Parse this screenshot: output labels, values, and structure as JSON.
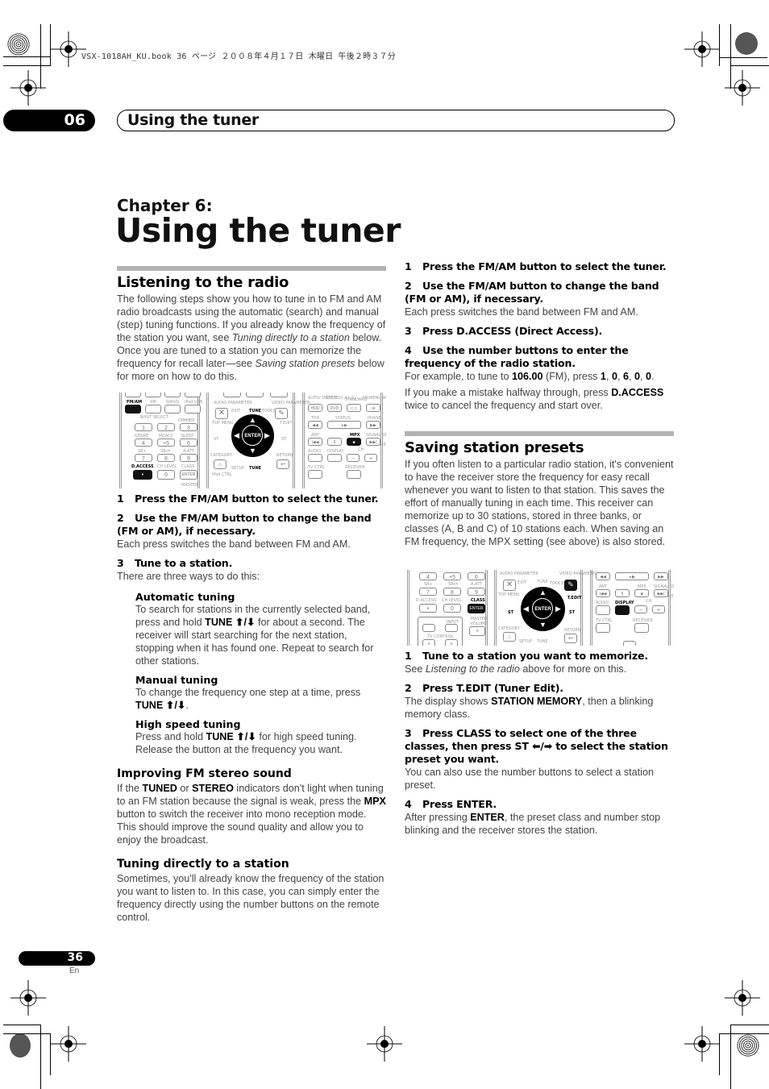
{
  "print_header": "VSX-1018AH_KU.book  36 ページ  ２００８年４月１７日  木曜日  午後２時３７分",
  "chapter_tab": {
    "number": "06"
  },
  "running_header": {
    "title": "Using the tuner"
  },
  "chapter": {
    "label": "Chapter 6:",
    "title": "Using the tuner"
  },
  "left_column": {
    "listening": {
      "heading": "Listening to the radio",
      "intro_parts": [
        "The following steps show you how to tune in to FM and AM radio broadcasts using the automatic (search) and manual (step) tuning functions. If you already know the frequency of the station you want, see ",
        "Tuning directly to a station",
        " below. Once you are tuned to a station you can memorize the frequency for recall later—see ",
        "Saving station presets",
        " below for more on how to do this."
      ]
    },
    "steps": [
      {
        "num": "1",
        "title": "Press the FM/AM button to select the tuner."
      },
      {
        "num": "2",
        "title": "Use the FM/AM button to change the band (FM or AM), if necessary.",
        "body": "Each press switches the band between FM and AM."
      },
      {
        "num": "3",
        "title": "Tune to a station.",
        "body": "There are three ways to do this:"
      }
    ],
    "tuning_methods": [
      {
        "heading": "Automatic tuning",
        "pre": "To search for stations in the currently selected band, press and hold ",
        "bold": "TUNE ⬆/⬇",
        "post": " for about a second. The receiver will start searching for the next station, stopping when it has found one. Repeat to search for other stations."
      },
      {
        "heading": "Manual tuning",
        "pre": "To change the frequency one step at a time, press ",
        "bold": "TUNE ⬆/⬇",
        "post": "."
      },
      {
        "heading": "High speed tuning",
        "pre": "Press and hold ",
        "bold": "TUNE ⬆/⬇",
        "post": " for high speed tuning. Release the button at the frequency you want."
      }
    ],
    "improving": {
      "heading": "Improving FM stereo sound",
      "parts": [
        "If the ",
        "TUNED",
        " or ",
        "STEREO",
        " indicators don't light when tuning to an FM station because the signal is weak, press the ",
        "MPX",
        " button to switch the receiver into mono reception mode. This should improve the sound quality and allow you to enjoy the broadcast."
      ]
    },
    "direct": {
      "heading": "Tuning directly to a station",
      "body": "Sometimes, you'll already know the frequency of the station you want to listen to. In this case, you can simply enter the frequency directly using the number buttons on the remote control."
    }
  },
  "right_column": {
    "direct_steps": [
      {
        "num": "1",
        "title": "Press the FM/AM button to select the tuner."
      },
      {
        "num": "2",
        "title": "Use the FM/AM button to change the band (FM or AM), if necessary.",
        "body": "Each press switches the band between FM and AM."
      },
      {
        "num": "3",
        "title": "Press D.ACCESS (Direct Access)."
      },
      {
        "num": "4",
        "title": "Use the number buttons to enter the frequency of the radio station."
      }
    ],
    "example_parts": [
      "For example, to tune to ",
      "106.00",
      " (FM), press ",
      "1",
      ", ",
      "0",
      ", ",
      "6",
      ", ",
      "0",
      ", ",
      "0",
      "."
    ],
    "mistake_parts": [
      "If you make a mistake halfway through, press ",
      "D.ACCESS",
      " twice to cancel the frequency and start over."
    ],
    "saving": {
      "heading": "Saving station presets",
      "body": "If you often listen to a particular radio station, it's convenient to have the receiver store the frequency for easy recall whenever you want to listen to that station. This saves the effort of manually tuning in each time. This receiver can memorize up to 30 stations, stored in three banks, or classes (A, B and C) of 10 stations each. When saving an FM frequency, the MPX setting (see above) is also stored."
    },
    "preset_steps": [
      {
        "num": "1",
        "title": "Tune to a station you want to memorize.",
        "body_parts": [
          "See ",
          "Listening to the radio",
          " above for more on this."
        ]
      },
      {
        "num": "2",
        "title": "Press T.EDIT (Tuner Edit).",
        "body_parts": [
          "The display shows ",
          "STATION MEMORY",
          ", then a blinking memory class."
        ]
      },
      {
        "num": "3",
        "title": "Press CLASS to select one of the three classes, then press ST ⬅/➡ to select the station preset you want.",
        "body": "You can also use the number buttons to select a station preset."
      },
      {
        "num": "4",
        "title": "Press ENTER.",
        "body_parts": [
          "After pressing ",
          "ENTER",
          ", the preset class and number stop blinking and the receiver stores the station."
        ]
      }
    ]
  },
  "remote1": {
    "top_row": [
      "FM/AM",
      "XM",
      "SIRIUS",
      "iPod USB"
    ],
    "input_select": "INPUT SELECT",
    "dimmer": "DIMMER",
    "num_labels": [
      "GENRE",
      "MCACC",
      "SLEEP",
      "SR+",
      "SBch",
      "A.ATT",
      "D.ACCESS",
      "CH LEVEL",
      "CLASS"
    ],
    "nums": [
      "1",
      "2",
      "3",
      "4",
      "+5",
      "6",
      "7",
      "8",
      "9",
      "•",
      "0",
      "ENTER"
    ],
    "master": "MASTER",
    "center": {
      "audio_param": "AUDIO PARAMETER",
      "exit": "EXIT",
      "tune": "TUNE",
      "tools": "TOOLS",
      "video_param": "VIDEO PARAMETER",
      "top_menu": "TOP MENU",
      "menu": "MENU",
      "tedit": "T.EDIT",
      "st": "ST",
      "enter": "ENTER",
      "category": "CATEGORY",
      "setup": "SETUP",
      "return": "RETURN",
      "ipod_ctrl": "iPod CTRL"
    },
    "right": {
      "row1": [
        "AUTO/ DIRECT",
        "STEREO/ A.L.C.",
        "STANDARD",
        "SB/MENU ADV.SURR"
      ],
      "row1_btns": [
        "HDD",
        "DVD",
        "⊂⊃",
        "⋊"
      ],
      "thx": "THX",
      "status": "STATUS",
      "phase": "PHASE",
      "ant": "ANT",
      "mpx": "MPX",
      "signal_sel": "SIGNAL SEL",
      "mem": "MEM",
      "audio": "AUDIO",
      "display": "DISPLAY",
      "ch": "CH",
      "tv_ctrl": "TV CTRL",
      "receiver": "RECEIVER"
    }
  },
  "remote2": {
    "nums": [
      "4",
      "+5",
      "6",
      "7",
      "8",
      "9",
      "•",
      "0",
      "ENTER"
    ],
    "num_labels": [
      "SR+",
      "SBch",
      "A.ATT",
      "D.ACCESS",
      "CH LEVEL",
      "CLASS"
    ],
    "input": "INPUT",
    "master_volume": "MASTER VOLUME",
    "tv_control": "TV CONTROL"
  },
  "footer": {
    "page_number": "36",
    "language": "En"
  }
}
